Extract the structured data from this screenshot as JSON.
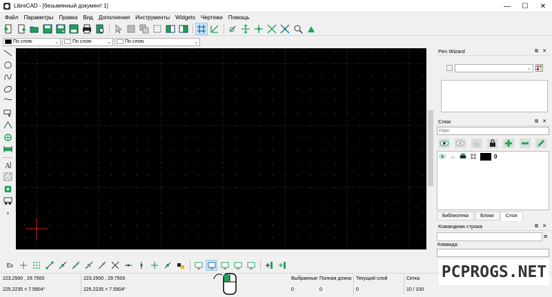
{
  "window": {
    "title": "LibreCAD - [безымянный документ 1]"
  },
  "menu": [
    "Файл",
    "Параметры",
    "Правка",
    "Вид",
    "Дополнения",
    "Инструменты",
    "Widgets",
    "Чертежи",
    "Помощь"
  ],
  "penbar": {
    "color_value": "По слою",
    "width_value": "По слою",
    "type_value": "По слою"
  },
  "pen_wizard": {
    "title": "Pen Wizard",
    "dropdown_value": ""
  },
  "layers": {
    "title": "Слои",
    "filter_placeholder": "Filter",
    "rows": [
      {
        "name": "0",
        "color": "#000000"
      }
    ]
  },
  "dock_tabs": [
    "Библиотека",
    "Блоки",
    "Слои"
  ],
  "command_line": {
    "title": "Командная строка",
    "prompt_label": "Команда:"
  },
  "snap_toolbar": {
    "ex_label": "Ex"
  },
  "status": {
    "abs_coords": "223.2500 , 29.7500",
    "abs_polar": "225.2235 < 7.5904°",
    "rel_coords": "223.2500 , 29.7500",
    "rel_polar": "225.2235 < 7.5904°",
    "selected_label": "Выбранные",
    "selected_value": "0",
    "total_length_label": "Полная длина",
    "total_length_value": "0",
    "current_layer_label": "Текущий слой",
    "current_layer_value": "0",
    "grid_label": "Сетка",
    "grid_value": "10 / 100"
  },
  "watermark": "PCPROGS.NET",
  "colors": {
    "accent": "#1fa35a",
    "canvas": "#000000",
    "grid": "#5a5a5a",
    "crosshair": "#d12020"
  }
}
